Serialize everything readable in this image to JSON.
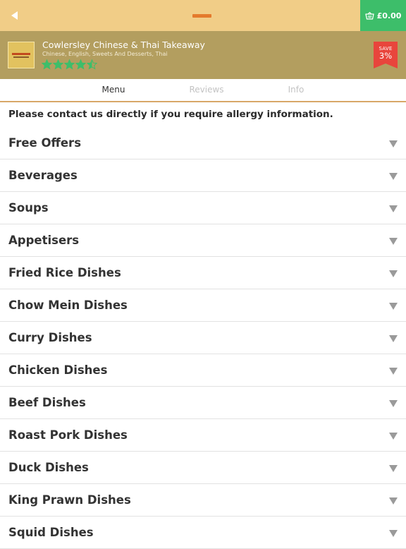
{
  "topbar": {
    "back_icon": "back-arrow-icon",
    "basket": {
      "icon": "basket-icon",
      "amount": "£0.00"
    }
  },
  "restaurant": {
    "name": "Cowlersley Chinese & Thai Takeaway",
    "cuisines": "Chinese, English, Sweets And Desserts, Thai",
    "rating": 4.5,
    "rating_max": 5,
    "badge": {
      "label": "SAVE",
      "value": "3%"
    }
  },
  "tabs": [
    {
      "label": "Menu",
      "active": true
    },
    {
      "label": "Reviews",
      "active": false
    },
    {
      "label": "Info",
      "active": false
    }
  ],
  "notice": "Please contact us directly if you require allergy information.",
  "categories": [
    "Free Offers",
    "Beverages",
    "Soups",
    "Appetisers",
    "Fried Rice Dishes",
    "Chow Mein Dishes",
    "Curry Dishes",
    "Chicken Dishes",
    "Beef Dishes",
    "Roast Pork Dishes",
    "Duck Dishes",
    "King Prawn Dishes",
    "Squid Dishes"
  ],
  "colors": {
    "topbar": "#f1cd87",
    "header": "#b39e5f",
    "basket": "#3dbe6a",
    "star": "#3dbe6a",
    "badge": "#e8453c",
    "tab_underline": "#d8a768"
  }
}
